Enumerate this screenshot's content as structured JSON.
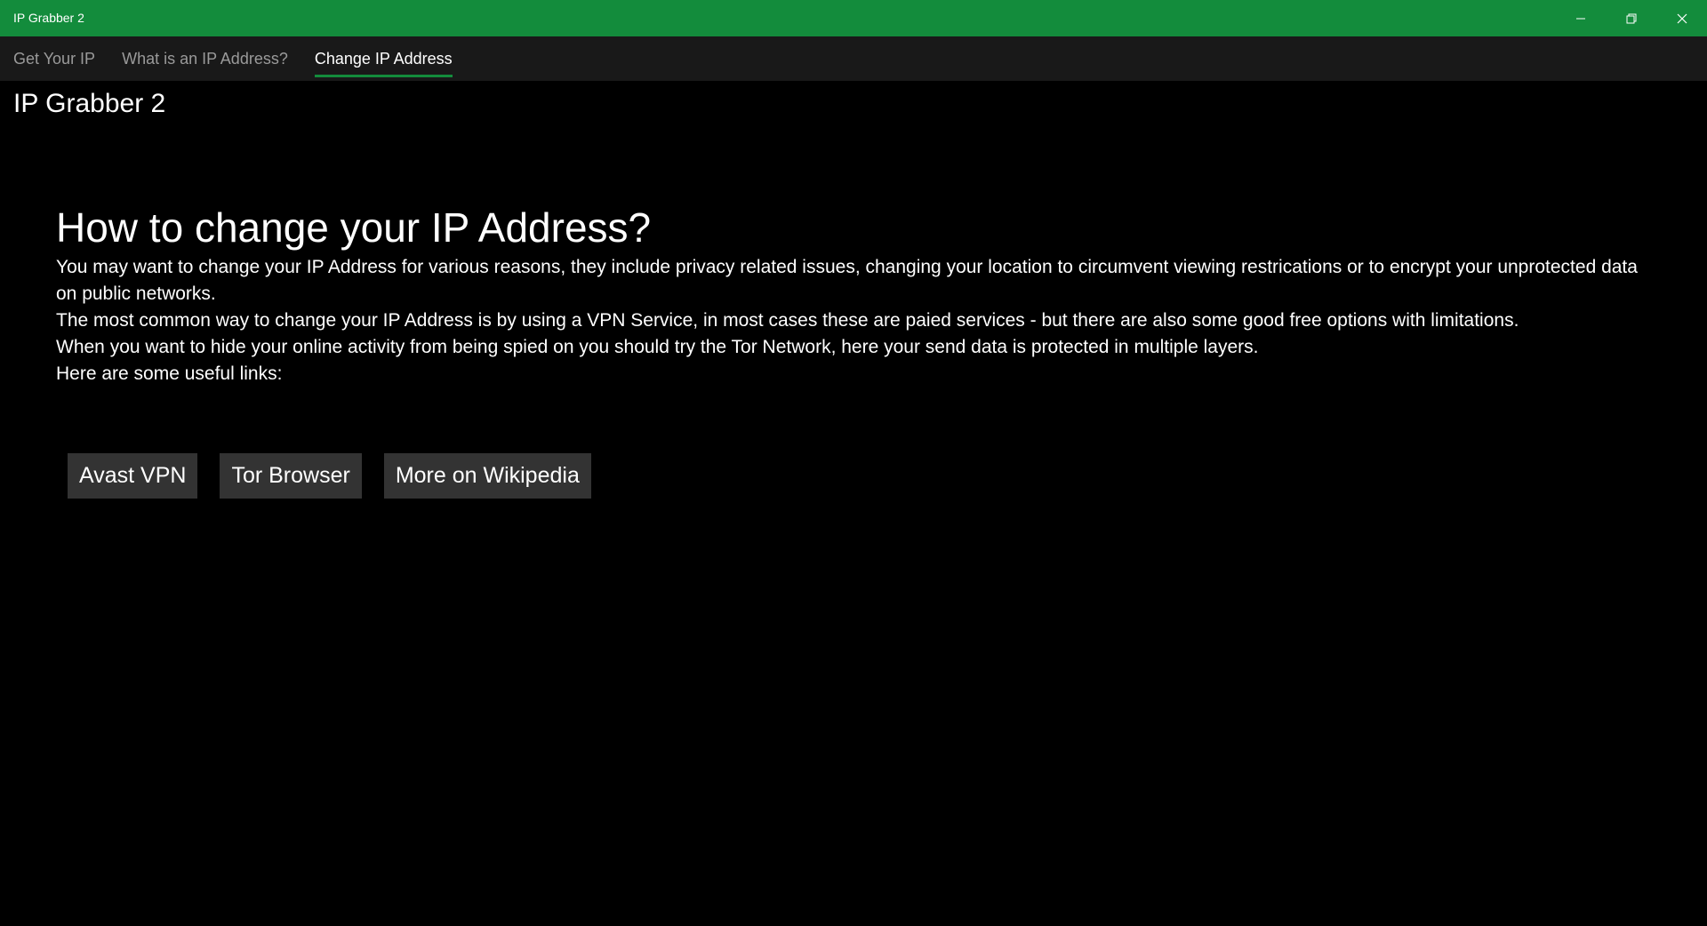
{
  "window": {
    "title": "IP Grabber 2",
    "accent_color": "#138c3c",
    "controls": [
      {
        "name": "minimize-icon"
      },
      {
        "name": "restore-icon"
      },
      {
        "name": "close-icon"
      }
    ]
  },
  "nav": {
    "tabs": [
      {
        "label": "Get Your IP",
        "active": false
      },
      {
        "label": "What is an IP Address?",
        "active": false
      },
      {
        "label": "Change IP Address",
        "active": true
      }
    ]
  },
  "page": {
    "app_title": "IP Grabber 2",
    "heading": "How to change your IP Address?",
    "paragraphs": [
      "You may want to change your IP Address for various reasons, they include privacy related issues, changing your location to circumvent viewing restrications or to encrypt your unprotected data on public networks.",
      "The most common way to change your IP Address is by using a VPN Service, in most cases these are paied services - but there are also some good free options with limitations.",
      "When you want to hide your online activity from being spied on you should try the Tor Network, here your send data is protected in multiple layers.",
      "Here are some useful links:"
    ],
    "links": [
      {
        "label": "Avast VPN"
      },
      {
        "label": "Tor Browser"
      },
      {
        "label": "More on Wikipedia"
      }
    ]
  }
}
